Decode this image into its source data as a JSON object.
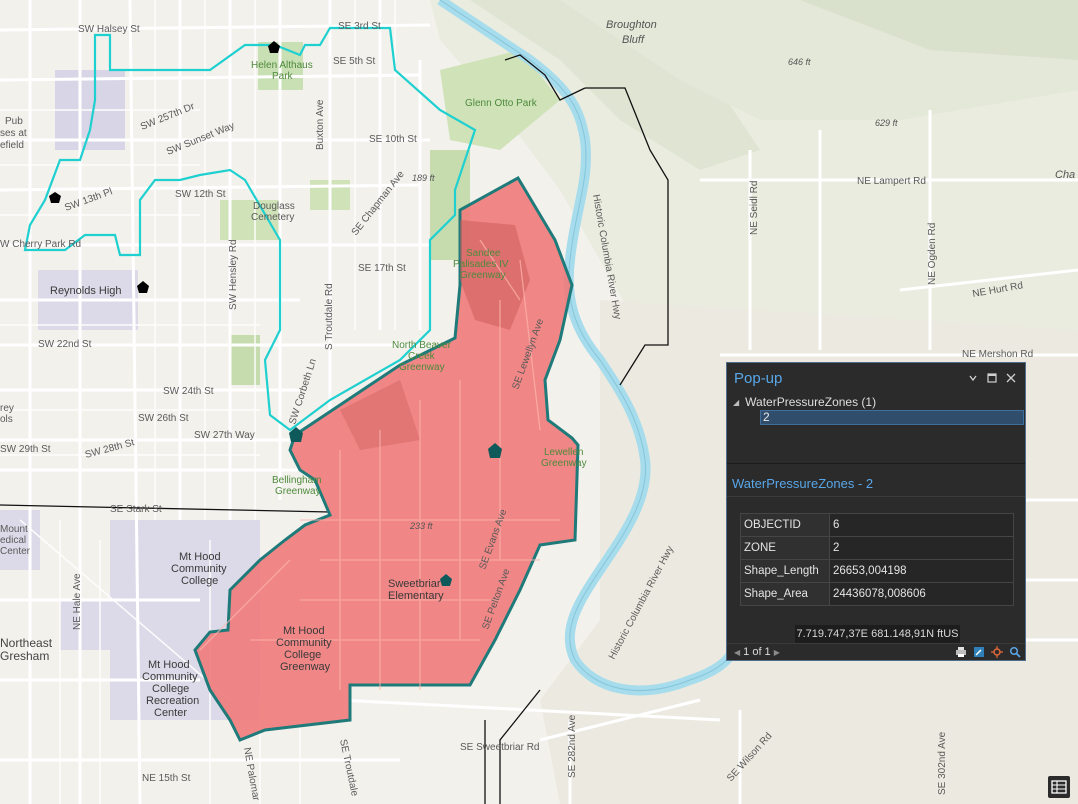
{
  "map": {
    "labels": {
      "sw_halsey": "SW Halsey St",
      "se_3rd": "SE 3rd St",
      "se_5th": "SE 5th St",
      "helen_althaus": "Helen Althaus",
      "helen_althaus_2": "Park",
      "broughton": "Broughton",
      "bluff": "Bluff",
      "elev_646": "646 ft",
      "elev_629": "629 ft",
      "elev_189": "189 ft",
      "elev_233": "233 ft",
      "glenn_otto": "Glenn Otto Park",
      "sw_257th": "SW 257th Dr",
      "sw_sunset": "SW Sunset Way",
      "buxton": "Buxton Ave",
      "se_10th": "SE 10th St",
      "pub": "Pub",
      "pub2": "ses at",
      "pub3": "efield",
      "sw_13th": "SW 13th Pl",
      "sw_12th": "SW 12th St",
      "douglass": "Douglass",
      "cemetery": "Cemetery",
      "se_chapman": "SE Chapman Ave",
      "ne_lampert": "NE Lampert Rd",
      "cha": "Cha",
      "cherry_park": "W Cherry Park Rd",
      "sw_hensley": "SW Hensley Rd",
      "se_17th": "SE 17th St",
      "sandee1": "Sandee",
      "sandee2": "Palisades IV",
      "sandee3": "Greenway",
      "hist_hwy": "Historic Columbia River Hwy",
      "ne_seidl": "NE Seidl Rd",
      "ne_hurt": "NE Hurt Rd",
      "ne_ogden": "NE Ogden Rd",
      "reynolds": "Reynolds High",
      "s_troutdale": "S Troutdale Rd",
      "se_lewellyn": "SE Lewellyn Ave",
      "sw_22nd": "SW 22nd St",
      "north_beaver1": "North Beaver",
      "north_beaver2": "Creek",
      "north_beaver3": "Greenway",
      "ne_mershon": "NE Mershon Rd",
      "sw_24th": "SW 24th St",
      "sw_corbeth": "SW Corbeth Ln",
      "sw_26th": "SW 26th St",
      "sw_27th": "SW 27th Way",
      "sw_28th": "SW 28th St",
      "sw_29th": "SW 29th St",
      "rey": "rey",
      "ols": "ols",
      "lewellen1": "Lewellen",
      "lewellen2": "Greenway",
      "bellingham1": "Bellingham",
      "bellingham2": "Greenway",
      "se_stark": "SE Stark St",
      "mt_hood_left1": "Mount",
      "mt_hood_left2": "edical",
      "mt_hood_left3": "Center",
      "mhcc1": "Mt Hood",
      "mhcc2": "Community",
      "mhcc3": "College",
      "se_evans": "SE Evans Ave",
      "hist_hwy2": "Historic Columbia River Hwy",
      "sweetbriar1": "Sweetbriar",
      "sweetbriar2": "Elementary",
      "se_pelton": "SE Pelton Ave",
      "ne_hale": "NE Hale Ave",
      "ne_gresham1": "Northeast",
      "ne_gresham2": "Gresham",
      "mhcc_green1": "Mt Hood",
      "mhcc_green2": "Community",
      "mhcc_green3": "College",
      "mhcc_green4": "Greenway",
      "mhcc_rec1": "Mt Hood",
      "mhcc_rec2": "Community",
      "mhcc_rec3": "College",
      "mhcc_rec4": "Recreation",
      "mhcc_rec5": "Center",
      "se_sweetbriar": "SE Sweetbriar Rd",
      "se_282nd": "SE 282nd Ave",
      "se_wilson": "SE Wilson Rd",
      "se_302nd": "SE 302nd Ave",
      "ne_15th": "NE 15th St",
      "ne_palomar": "NE Palomar",
      "se_troutdale": "SE Troutdale"
    },
    "colors": {
      "zone_fill": "#f07a7a",
      "zone_stroke": "#1f7a7a",
      "zone_outline": "#1fd0d0",
      "river": "#a6dcec",
      "hill": "#e6eadc"
    }
  },
  "popup": {
    "title": "Pop-up",
    "layer_label": "WaterPressureZones (1)",
    "feature_label": "2",
    "feature_title": "WaterPressureZones - 2",
    "attributes": [
      {
        "key": "OBJECTID",
        "value": "6"
      },
      {
        "key": "ZONE",
        "value": "2"
      },
      {
        "key": "Shape_Length",
        "value": "26653,004198"
      },
      {
        "key": "Shape_Area",
        "value": "24436078,008606"
      }
    ],
    "coordinates": "7.719.747,37E 681.148,91N ftUS",
    "pager": "1 of 1",
    "icons": [
      "menu-icon",
      "restore-icon",
      "close-icon",
      "collapse-caret-icon",
      "prev-icon",
      "next-icon",
      "print-icon",
      "edit-icon",
      "flash-icon",
      "zoom-to-icon"
    ]
  }
}
